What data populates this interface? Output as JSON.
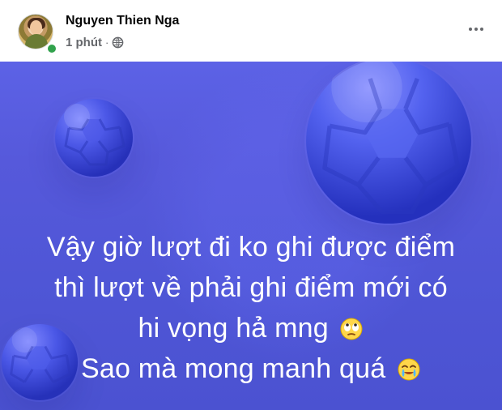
{
  "post": {
    "author_name": "Nguyen Thien Nga",
    "time": "1 phút",
    "separator": "·",
    "audience_icon": "globe-icon",
    "more_icon": "more-horizontal-icon",
    "avatar_icon": "profile-avatar-icon",
    "status_icon": "online-status-dot-icon"
  },
  "photo": {
    "background_color": "#5659db",
    "text_color": "#ffffff",
    "lines": [
      "Vậy giờ lượt đi ko ghi được điểm",
      "thì lượt về phải ghi điểm mới có",
      "hi vọng hả mng",
      "Sao mà mong manh quá"
    ],
    "line_3_emoji": "eye-roll-emoji-icon",
    "line_4_emoji": "crying-smile-emoji-icon"
  }
}
